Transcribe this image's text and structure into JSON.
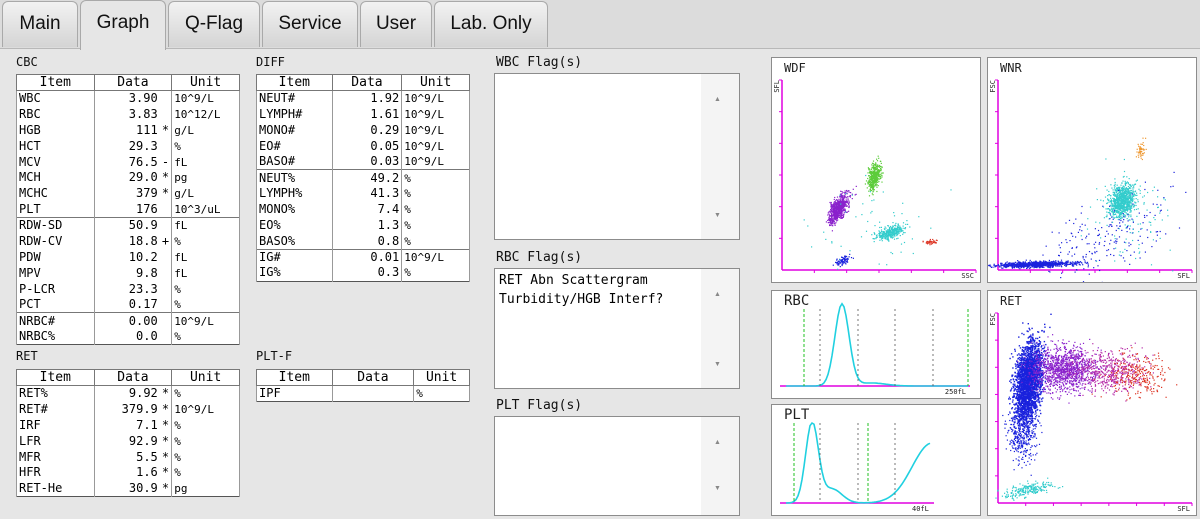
{
  "tabs": [
    {
      "label": "Main",
      "active": false
    },
    {
      "label": "Graph",
      "active": true
    },
    {
      "label": "Q-Flag",
      "active": false
    },
    {
      "label": "Service",
      "active": false
    },
    {
      "label": "User",
      "active": false
    },
    {
      "label": "Lab. Only",
      "active": false
    }
  ],
  "headers": {
    "item": "Item",
    "data": "Data",
    "unit": "Unit"
  },
  "cbc": {
    "title": "CBC",
    "groups": [
      [
        {
          "item": "WBC",
          "data": "3.90",
          "flag": "",
          "unit": "10^9/L"
        },
        {
          "item": "RBC",
          "data": "3.83",
          "flag": "",
          "unit": "10^12/L"
        },
        {
          "item": "HGB",
          "data": "111",
          "flag": "*",
          "unit": "g/L"
        },
        {
          "item": "HCT",
          "data": "29.3",
          "flag": "",
          "unit": "%"
        },
        {
          "item": "MCV",
          "data": "76.5",
          "flag": "-",
          "unit": "fL"
        },
        {
          "item": "MCH",
          "data": "29.0",
          "flag": "*",
          "unit": "pg"
        },
        {
          "item": "MCHC",
          "data": "379",
          "flag": "*",
          "unit": "g/L"
        },
        {
          "item": "PLT",
          "data": "176",
          "flag": "",
          "unit": "10^3/uL"
        }
      ],
      [
        {
          "item": "RDW-SD",
          "data": "50.9",
          "flag": "",
          "unit": "fL"
        },
        {
          "item": "RDW-CV",
          "data": "18.8",
          "flag": "+",
          "unit": "%"
        },
        {
          "item": "PDW",
          "data": "10.2",
          "flag": "",
          "unit": "fL"
        },
        {
          "item": "MPV",
          "data": "9.8",
          "flag": "",
          "unit": "fL"
        },
        {
          "item": "P-LCR",
          "data": "23.3",
          "flag": "",
          "unit": "%"
        },
        {
          "item": "PCT",
          "data": "0.17",
          "flag": "",
          "unit": "%"
        }
      ],
      [
        {
          "item": "NRBC#",
          "data": "0.00",
          "flag": "",
          "unit": "10^9/L"
        },
        {
          "item": "NRBC%",
          "data": "0.0",
          "flag": "",
          "unit": "%"
        }
      ]
    ]
  },
  "diff": {
    "title": "DIFF",
    "groups": [
      [
        {
          "item": "NEUT#",
          "data": "1.92",
          "unit": "10^9/L"
        },
        {
          "item": "LYMPH#",
          "data": "1.61",
          "unit": "10^9/L"
        },
        {
          "item": "MONO#",
          "data": "0.29",
          "unit": "10^9/L"
        },
        {
          "item": "EO#",
          "data": "0.05",
          "unit": "10^9/L"
        },
        {
          "item": "BASO#",
          "data": "0.03",
          "unit": "10^9/L"
        }
      ],
      [
        {
          "item": "NEUT%",
          "data": "49.2",
          "unit": "%"
        },
        {
          "item": "LYMPH%",
          "data": "41.3",
          "unit": "%"
        },
        {
          "item": "MONO%",
          "data": "7.4",
          "unit": "%"
        },
        {
          "item": "EO%",
          "data": "1.3",
          "unit": "%"
        },
        {
          "item": "BASO%",
          "data": "0.8",
          "unit": "%"
        }
      ],
      [
        {
          "item": "IG#",
          "data": "0.01",
          "unit": "10^9/L"
        },
        {
          "item": "IG%",
          "data": "0.3",
          "unit": "%"
        }
      ]
    ]
  },
  "ret": {
    "title": "RET",
    "rows": [
      {
        "item": "RET%",
        "data": "9.92",
        "flag": "*",
        "unit": "%"
      },
      {
        "item": "RET#",
        "data": "379.9",
        "flag": "*",
        "unit": "10^9/L"
      },
      {
        "item": "IRF",
        "data": "7.1",
        "flag": "*",
        "unit": "%"
      },
      {
        "item": "LFR",
        "data": "92.9",
        "flag": "*",
        "unit": "%"
      },
      {
        "item": "MFR",
        "data": "5.5",
        "flag": "*",
        "unit": "%"
      },
      {
        "item": "HFR",
        "data": "1.6",
        "flag": "*",
        "unit": "%"
      },
      {
        "item": "RET-He",
        "data": "30.9",
        "flag": "*",
        "unit": "pg"
      }
    ]
  },
  "pltf": {
    "title": "PLT-F",
    "rows": [
      {
        "item": "IPF",
        "data": "",
        "unit": "%"
      }
    ]
  },
  "flags": {
    "wbc": {
      "title": "WBC Flag(s)",
      "text": ""
    },
    "rbc": {
      "title": "RBC Flag(s)",
      "text": "RET Abn Scattergram\nTurbidity/HGB Interf?"
    },
    "plt": {
      "title": "PLT Flag(s)",
      "text": ""
    }
  },
  "graphs": {
    "wdf": {
      "title": "WDF",
      "yaxis": "SFL",
      "xaxis": "SSC"
    },
    "wnr": {
      "title": "WNR",
      "yaxis": "FSC",
      "xaxis": "SFL"
    },
    "rbc": {
      "title": "RBC",
      "xaxis": "250fL"
    },
    "plt": {
      "title": "PLT",
      "xaxis": "40fL"
    },
    "ret": {
      "title": "RET",
      "yaxis": "FSC",
      "xaxis": "SFL"
    }
  },
  "colors": {
    "axis": "#e000e0",
    "curve": "#20d0e0",
    "discriminator": "#20c020",
    "purple": "#8a22cc",
    "green": "#5ccc3a",
    "cyan": "#33cccc",
    "red": "#dd3322",
    "blue": "#1a22dd",
    "orange": "#ee9933"
  }
}
